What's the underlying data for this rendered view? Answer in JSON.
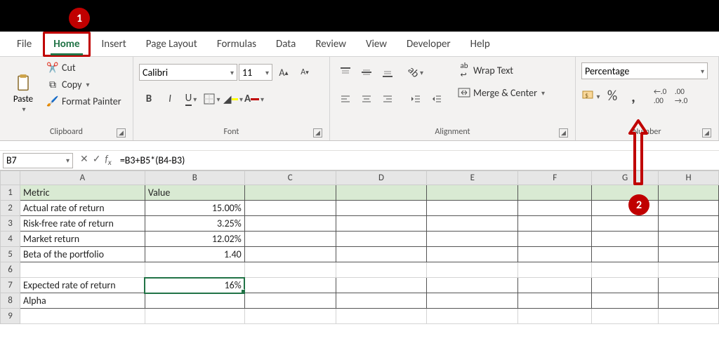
{
  "callouts": {
    "one": "1",
    "two": "2"
  },
  "tabs": {
    "file": "File",
    "home": "Home",
    "insert": "Insert",
    "page_layout": "Page Layout",
    "formulas": "Formulas",
    "data": "Data",
    "review": "Review",
    "view": "View",
    "developer": "Developer",
    "help": "Help"
  },
  "clipboard": {
    "paste": "Paste",
    "cut": "Cut",
    "copy": "Copy",
    "format_painter": "Format Painter",
    "group": "Clipboard"
  },
  "font": {
    "name": "Calibri",
    "size": "11",
    "group": "Font",
    "bold": "B",
    "italic": "I",
    "underline": "U"
  },
  "alignment": {
    "wrap": "Wrap Text",
    "merge": "Merge & Center",
    "group": "Alignment"
  },
  "number": {
    "format": "Percentage",
    "group": "Number",
    "percent": "%",
    "comma": ","
  },
  "namebox": "B7",
  "formula": "=B3+B5*(B4-B3)",
  "cols": {
    "A": "A",
    "B": "B",
    "C": "C",
    "D": "D",
    "E": "E",
    "F": "F",
    "G": "G",
    "H": "H"
  },
  "rows": {
    "r1": "1",
    "r2": "2",
    "r3": "3",
    "r4": "4",
    "r5": "5",
    "r6": "6",
    "r7": "7",
    "r8": "8",
    "r9": "9"
  },
  "data": {
    "A1": "Metric",
    "B1": "Value",
    "A2": "Actual rate of return",
    "B2": "15.00%",
    "A3": "Risk-free rate of return",
    "B3": "3.25%",
    "A4": "Market return",
    "B4": "12.02%",
    "A5": "Beta of the portfolio",
    "B5": "1.40",
    "A7": "Expected rate of return",
    "B7": "16%",
    "A8": "Alpha"
  },
  "chart_data": {
    "type": "table",
    "title": "",
    "columns": [
      "Metric",
      "Value"
    ],
    "rows": [
      {
        "metric": "Actual rate of return",
        "value": 0.15
      },
      {
        "metric": "Risk-free rate of return",
        "value": 0.0325
      },
      {
        "metric": "Market return",
        "value": 0.1202
      },
      {
        "metric": "Beta of the portfolio",
        "value": 1.4
      },
      {
        "metric": "Expected rate of return",
        "value": 0.16
      },
      {
        "metric": "Alpha",
        "value": null
      }
    ],
    "selected_cell": "B7",
    "selected_formula": "=B3+B5*(B4-B3)"
  }
}
